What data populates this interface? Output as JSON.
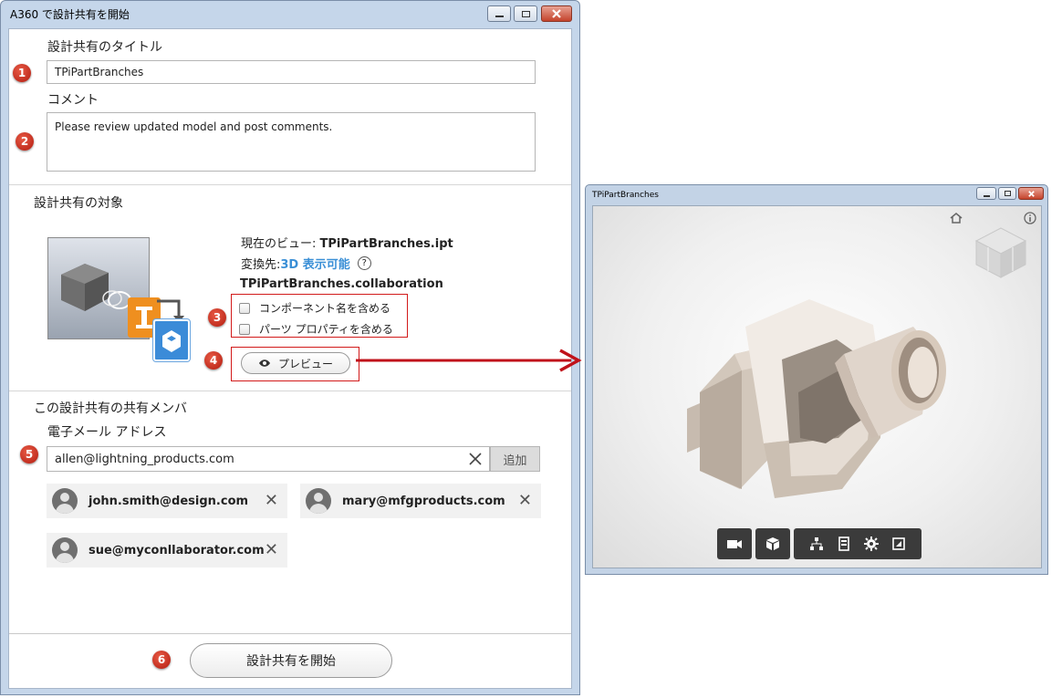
{
  "dialog": {
    "title": "A360 で設計共有を開始",
    "title_label": "設計共有のタイトル",
    "title_value": "TPiPartBranches",
    "comment_label": "コメント",
    "comment_value": "Please review updated model and post comments.",
    "target_label": "設計共有の対象",
    "current_view_label": "現在のビュー: ",
    "current_view_value": "TPiPartBranches.ipt",
    "convert_label": "変換先: ",
    "convert_value": "3D 表示可能",
    "help_glyph": "?",
    "collab_name": "TPiPartBranches.collaboration",
    "option_component_names": "コンポーネント名を含める",
    "option_part_properties": "パーツ プロパティを含める",
    "preview_button": "プレビュー",
    "members_label": "この設計共有の共有メンバ",
    "email_label": "電子メール アドレス",
    "email_value": "allen@lightning_products.com",
    "add_button": "追加",
    "members": [
      {
        "email": "john.smith@design.com"
      },
      {
        "email": "mary@mfgproducts.com"
      },
      {
        "email": "sue@myconllaborator.com"
      }
    ],
    "start_button": "設計共有を開始",
    "steps": [
      "1",
      "2",
      "3",
      "4",
      "5",
      "6"
    ]
  },
  "preview_window": {
    "title": "TPiPartBranches",
    "toolbar_icons": [
      "camera-icon",
      "cube-icon",
      "model-tree-icon",
      "properties-icon",
      "settings-icon",
      "fullscreen-icon"
    ]
  },
  "colors": {
    "accent_blue": "#3a8fd6",
    "callout_red": "#d21a1a",
    "step_badge": "#c62a1a"
  }
}
